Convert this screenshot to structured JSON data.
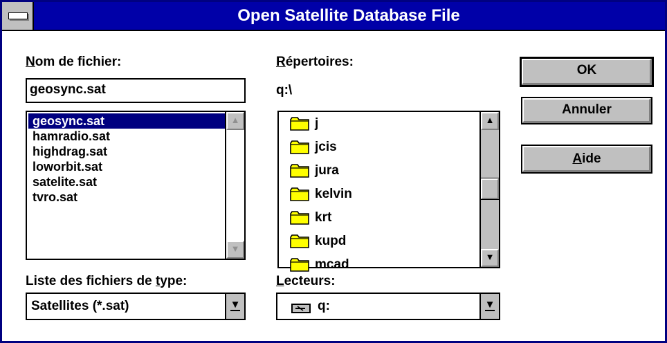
{
  "window": {
    "title": "Open Satellite Database File"
  },
  "filename": {
    "label_mnemonic": "N",
    "label_rest": "om de fichier:",
    "value": "geosync.sat",
    "files": [
      "geosync.sat",
      "hamradio.sat",
      "highdrag.sat",
      "loworbit.sat",
      "satelite.sat",
      "tvro.sat"
    ],
    "selected_index": 0
  },
  "directories": {
    "label_mnemonic": "R",
    "label_rest": "épertoires:",
    "current_path": "q:\\",
    "items": [
      "j",
      "jcis",
      "jura",
      "kelvin",
      "krt",
      "kupd",
      "mcad"
    ]
  },
  "file_type": {
    "label_prefix": "Liste des fichiers de ",
    "label_mnemonic": "t",
    "label_rest": "ype:",
    "value": "Satellites (*.sat)"
  },
  "drives": {
    "label_mnemonic": "L",
    "label_rest": "ecteurs:",
    "value": "q:"
  },
  "buttons": {
    "ok": "OK",
    "cancel": "Annuler",
    "help_mnemonic": "A",
    "help_rest": "ide"
  },
  "icons": {
    "system_menu": "system-menu-icon",
    "folder": "folder-icon",
    "drive": "network-drive-icon",
    "scroll_up": "▲",
    "scroll_down": "▼",
    "dropdown": "▼"
  },
  "colors": {
    "titlebar": "#0000a8",
    "selection": "#000080",
    "button_face": "#c0c0c0",
    "folder": "#ffff00"
  }
}
